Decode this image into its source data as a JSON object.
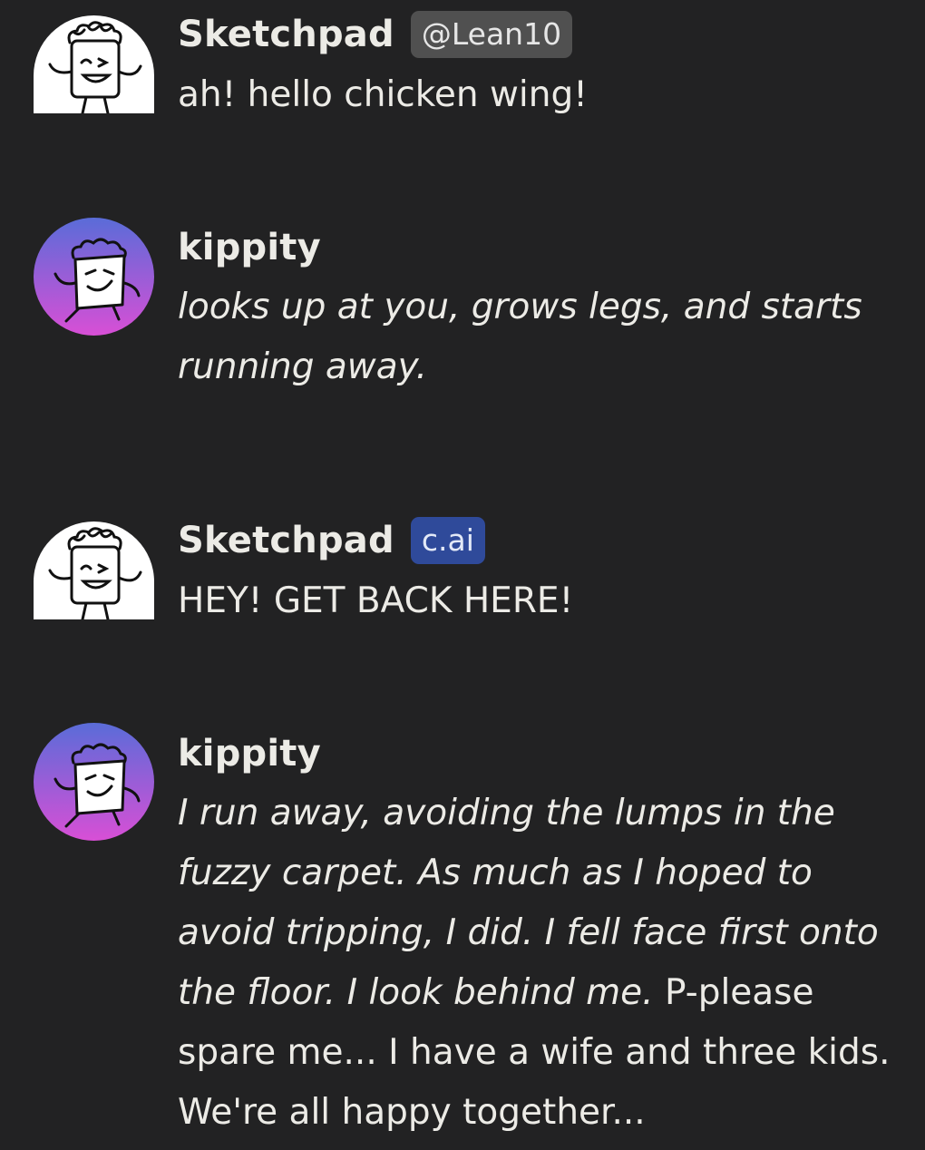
{
  "messages": [
    {
      "author": "Sketchpad",
      "badge": "@Lean10",
      "avatar_icon": "sketchpad-avatar-icon",
      "text": "ah! hello chicken wing!"
    },
    {
      "author": "kippity",
      "avatar_icon": "kippity-avatar-icon",
      "text": "looks up at you, grows legs, and starts running away."
    },
    {
      "author": "Sketchpad",
      "badge": "c.ai",
      "avatar_icon": "sketchpad-avatar-icon",
      "text": "HEY! GET BACK HERE!"
    },
    {
      "author": "kippity",
      "avatar_icon": "kippity-avatar-icon",
      "text_italic": "I run away, avoiding the lumps in the fuzzy carpet. As much as I hoped to avoid tripping, I did. I fell face first onto the floor. I look behind me.",
      "text_plain": " P-please spare me... I have a wife and three kids. We're all happy together..."
    }
  ],
  "colors": {
    "background": "#222223",
    "text": "#ecebe6",
    "user_badge": "#505050",
    "ai_badge": "#2f4a9a",
    "kippity_avatar_top": "#5a6cd8",
    "kippity_avatar_bottom": "#d84fd6"
  }
}
